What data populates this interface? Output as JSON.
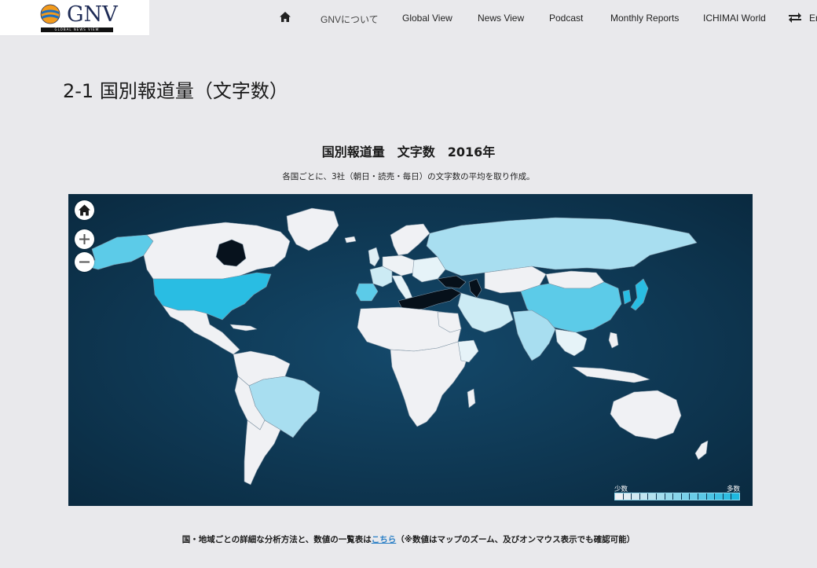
{
  "header": {
    "logo_text": "GNV",
    "logo_tagline": "GLOBAL NEWS VIEW",
    "nav": [
      {
        "label": "GNVについて"
      },
      {
        "label": "Global View"
      },
      {
        "label": "News View"
      },
      {
        "label": "Podcast"
      },
      {
        "label": "Monthly Reports"
      },
      {
        "label": "ICHIMAI World"
      },
      {
        "label": "En"
      }
    ],
    "icons": {
      "home": "home-icon",
      "language_switch": "swap-arrows-icon"
    }
  },
  "page": {
    "title": "2-1 国別報道量（文字数）"
  },
  "chart": {
    "title": "国別報道量　文字数　2016年",
    "subtitle": "各国ごとに、3社（朝日・読売・毎日）の文字数の平均を取り作成。",
    "controls": {
      "home": "home-icon",
      "zoom_in": "plus-icon",
      "zoom_out": "minus-icon"
    },
    "legend": {
      "low_label": "少数",
      "high_label": "多数",
      "steps": 15
    }
  },
  "chart_data": {
    "type": "heatmap",
    "title": "国別報道量　文字数　2016年",
    "scale": {
      "low": "少数",
      "high": "多数"
    },
    "colors": {
      "ocean": "#0c3450",
      "low": "#f0f1f4",
      "mid": "#8fd3e8",
      "high": "#1fb8e0",
      "highest": "#06101a"
    }
  },
  "footer": {
    "note_before": "国・地域ごとの詳細な分析方法と、数値の一覧表は",
    "link_text": "こちら",
    "note_after": "（※数値はマップのズーム、及びオンマウス表示でも確認可能）"
  }
}
